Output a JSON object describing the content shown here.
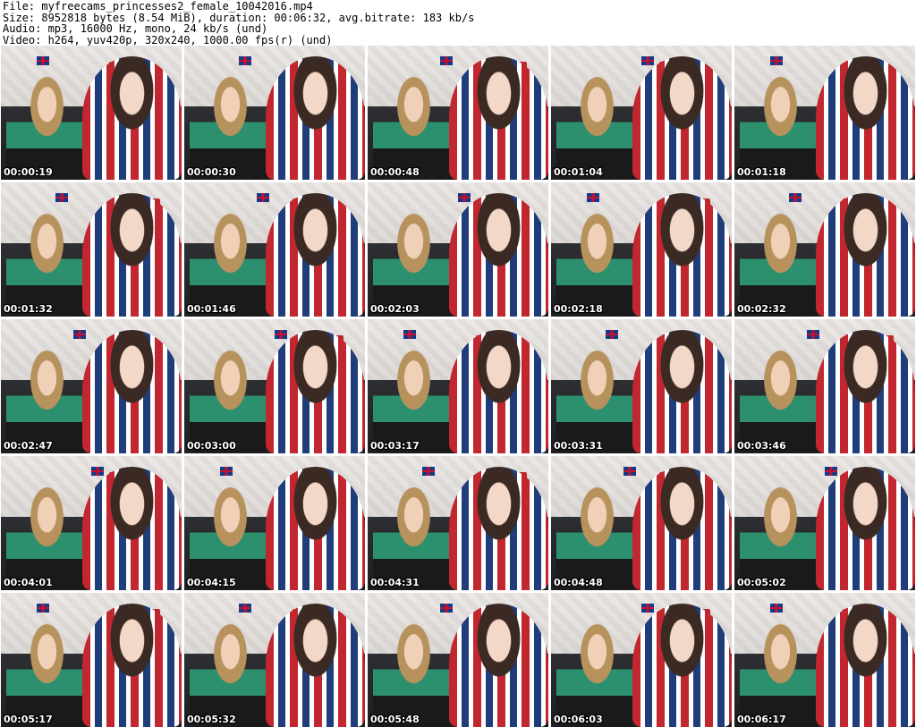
{
  "header": {
    "lines": [
      "File: myfreecams_princesses2_female_10042016.mp4",
      "Size: 8952818 bytes (8.54 MiB), duration: 00:06:32, avg.bitrate: 183 kb/s",
      "Audio: mp3, 16000 Hz, mono, 24 kb/s (und)",
      "Video: h264, yuv420p, 320x240, 1000.00 fps(r) (und)"
    ]
  },
  "thumbnails": [
    {
      "timestamp": "00:00:19"
    },
    {
      "timestamp": "00:00:30"
    },
    {
      "timestamp": "00:00:48"
    },
    {
      "timestamp": "00:01:04"
    },
    {
      "timestamp": "00:01:18"
    },
    {
      "timestamp": "00:01:32"
    },
    {
      "timestamp": "00:01:46"
    },
    {
      "timestamp": "00:02:03"
    },
    {
      "timestamp": "00:02:18"
    },
    {
      "timestamp": "00:02:32"
    },
    {
      "timestamp": "00:02:47"
    },
    {
      "timestamp": "00:03:00"
    },
    {
      "timestamp": "00:03:17"
    },
    {
      "timestamp": "00:03:31"
    },
    {
      "timestamp": "00:03:46"
    },
    {
      "timestamp": "00:04:01"
    },
    {
      "timestamp": "00:04:15"
    },
    {
      "timestamp": "00:04:31"
    },
    {
      "timestamp": "00:04:48"
    },
    {
      "timestamp": "00:05:02"
    },
    {
      "timestamp": "00:05:17"
    },
    {
      "timestamp": "00:05:32"
    },
    {
      "timestamp": "00:05:48"
    },
    {
      "timestamp": "00:06:03"
    },
    {
      "timestamp": "00:06:17"
    }
  ]
}
